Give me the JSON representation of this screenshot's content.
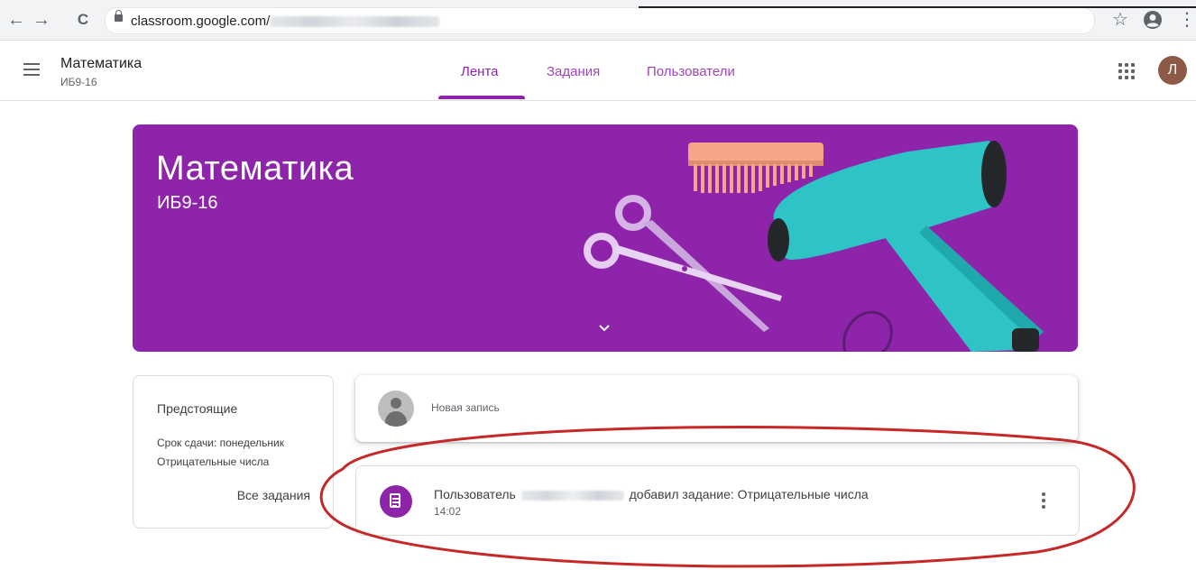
{
  "browser": {
    "url_prefix": "classroom.google.com/",
    "back_glyph": "←",
    "forward_glyph": "→",
    "reload_glyph": "C",
    "star_glyph": "☆",
    "menu_glyph": "⋮"
  },
  "appbar": {
    "class_title": "Математика",
    "class_section": "ИБ9-16",
    "tabs": [
      {
        "label": "Лента",
        "active": true
      },
      {
        "label": "Задания",
        "active": false
      },
      {
        "label": "Пользователи",
        "active": false
      }
    ],
    "avatar_letter": "Л"
  },
  "banner": {
    "title": "Математика",
    "section": "ИБ9-16",
    "chevron": "⌄",
    "color": "#8e24aa"
  },
  "upcoming": {
    "title": "Предстоящие",
    "due": "Срок сдачи: понедельник",
    "item": "Отрицательные числа",
    "view_all": "Все задания"
  },
  "new_post": {
    "placeholder": "Новая запись"
  },
  "stream_post": {
    "prefix": "Пользователь",
    "suffix": "добавил задание: Отрицательные числа",
    "time": "14:02",
    "icon": "assignment-icon"
  },
  "colors": {
    "accent": "#8e24aa",
    "annotation": "#c62828",
    "avatar_bg": "#8d5a48"
  }
}
